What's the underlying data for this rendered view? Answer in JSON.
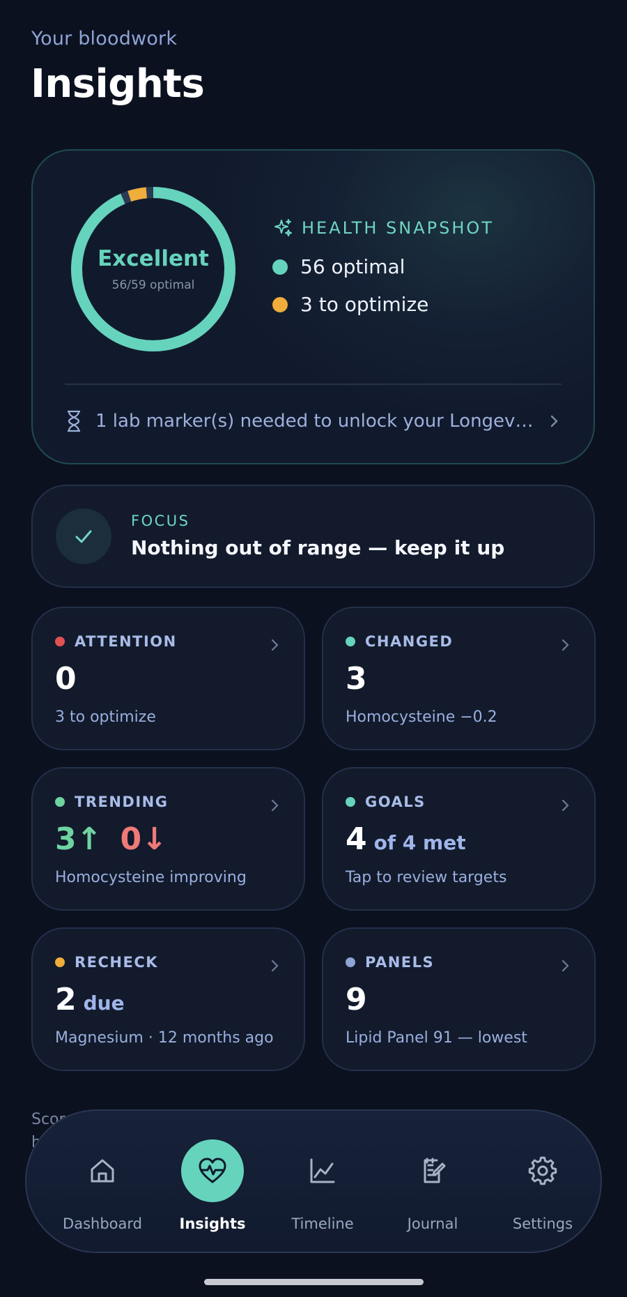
{
  "header": {
    "eyebrow": "Your bloodwork",
    "title": "Insights"
  },
  "snapshot": {
    "score_label": "Excellent",
    "score_sub": "56/59 optimal",
    "heading": "HEALTH SNAPSHOT",
    "optimal_count": 56,
    "to_optimize_count": 3,
    "total": 59,
    "legend_optimal": "56 optimal",
    "legend_optimize": "3 to optimize",
    "unlock_text": "1 lab marker(s) needed to unlock your Longevity …",
    "colors": {
      "optimal": "#66d3bd",
      "optimize": "#f0ad3c",
      "track": "#2a3a55"
    }
  },
  "focus": {
    "label": "FOCUS",
    "message": "Nothing out of range — keep it up"
  },
  "cards": {
    "attention": {
      "label": "ATTENTION",
      "value": "0",
      "sub": "3 to optimize",
      "dot": "#e05252"
    },
    "changed": {
      "label": "CHANGED",
      "value": "3",
      "sub": "Homocysteine −0.2",
      "dot": "#66d3bd"
    },
    "trending": {
      "label": "TRENDING",
      "up": "3↑",
      "down": "0↓",
      "sub": "Homocysteine improving",
      "dot": "#6fd3a0"
    },
    "goals": {
      "label": "GOALS",
      "value": "4",
      "unit": "of 4 met",
      "sub": "Tap to review targets",
      "dot": "#66d3bd"
    },
    "recheck": {
      "label": "RECHECK",
      "value": "2",
      "unit": "due",
      "sub": "Magnesium · 12 months ago",
      "dot": "#f0ad3c"
    },
    "panels": {
      "label": "PANELS",
      "value": "9",
      "sub": "Lipid Panel 91 — lowest",
      "dot": "#8fa4d6"
    }
  },
  "underlay": {
    "line1": "Scor",
    "line2": "h"
  },
  "nav": {
    "items": [
      {
        "label": "Dashboard",
        "icon": "home-icon"
      },
      {
        "label": "Insights",
        "icon": "heart-pulse-icon",
        "active": true
      },
      {
        "label": "Timeline",
        "icon": "line-chart-icon"
      },
      {
        "label": "Journal",
        "icon": "journal-edit-icon"
      },
      {
        "label": "Settings",
        "icon": "gear-icon"
      }
    ]
  }
}
